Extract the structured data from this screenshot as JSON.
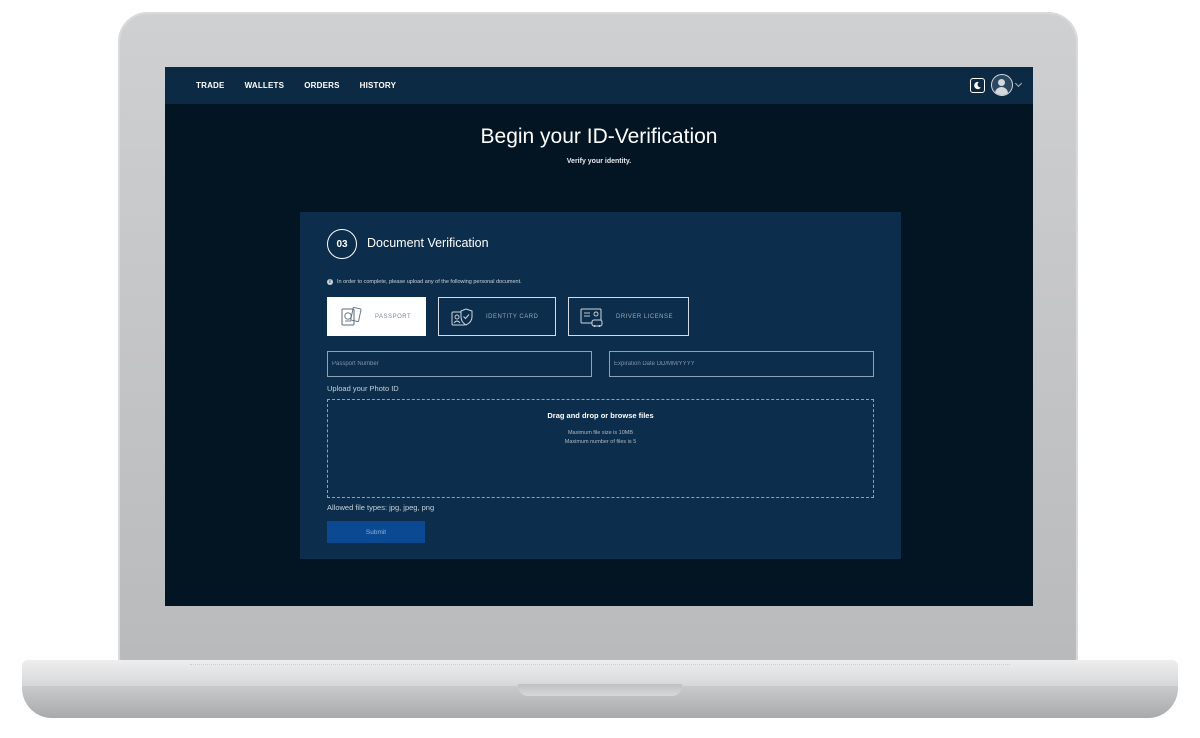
{
  "nav": {
    "items": [
      "TRADE",
      "WALLETS",
      "ORDERS",
      "HISTORY"
    ]
  },
  "page": {
    "title": "Begin your ID-Verification",
    "subtitle": "Verify your identity."
  },
  "card": {
    "step_number": "03",
    "step_title": "Document Verification",
    "info_text": "In order to complete, please upload any of the following personal document.",
    "doc_types": [
      {
        "label": "PASSPORT",
        "icon": "passport-icon",
        "selected": true
      },
      {
        "label": "IDENTITY CARD",
        "icon": "identity-card-icon",
        "selected": false
      },
      {
        "label": "DRIVER LICENSE",
        "icon": "driver-license-icon",
        "selected": false
      }
    ],
    "passport_placeholder": "Passport Number",
    "expiration_placeholder": "Expiration Date DD/MM/YYYY",
    "upload_label": "Upload your Photo ID",
    "dropzone": {
      "title": "Drag and drop or browse files",
      "max_size": "Maximum file size is 10MB",
      "max_files": "Maximum number of files is 5"
    },
    "allowed_types": "Allowed file types: jpg, jpeg, png",
    "submit_label": "Submit"
  },
  "colors": {
    "screen_bg": "#031423",
    "navbar_bg": "#0d2a44",
    "card_bg": "#0c2d4b",
    "submit_bg": "#0b4a93"
  }
}
